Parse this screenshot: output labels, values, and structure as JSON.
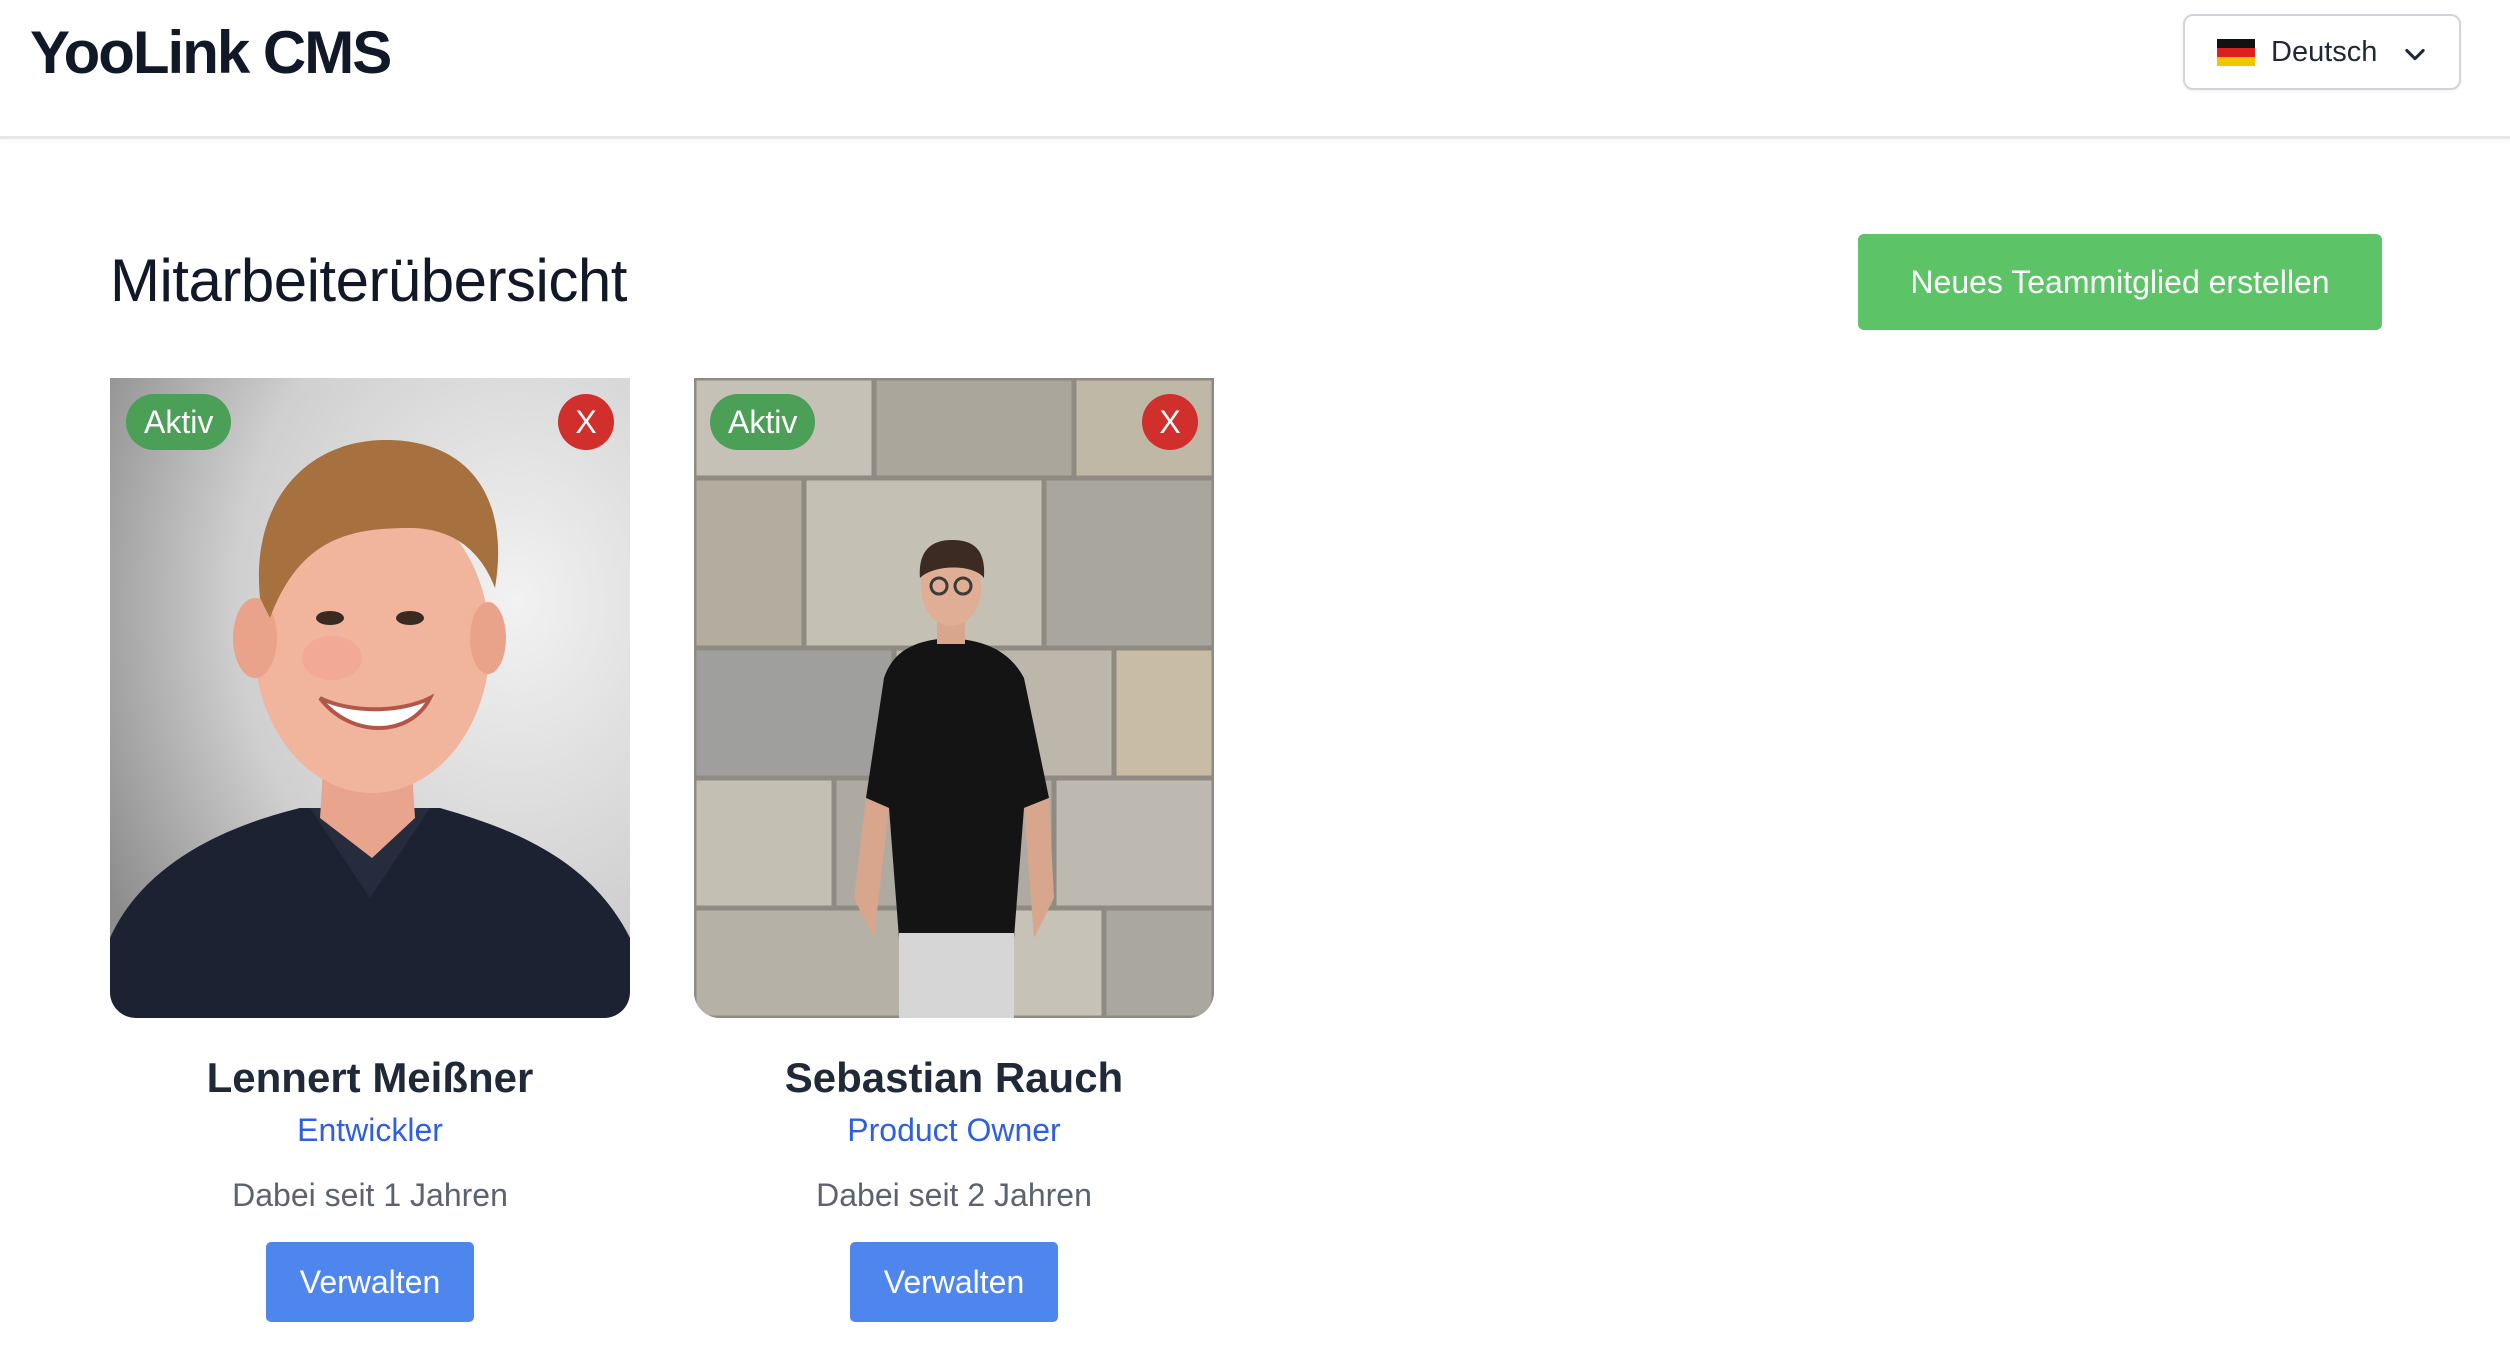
{
  "header": {
    "brand": "YooLink CMS",
    "language": {
      "selected": "Deutsch",
      "flag": "de"
    }
  },
  "main": {
    "title": "Mitarbeiterübersicht",
    "create_label": "Neues Teammitglied erstellen",
    "members": [
      {
        "name": "Lennert Meißner",
        "role": "Entwickler",
        "since": "Dabei seit 1 Jahren",
        "status": "Aktiv",
        "remove_label": "X",
        "manage_label": "Verwalten"
      },
      {
        "name": "Sebastian Rauch",
        "role": "Product Owner",
        "since": "Dabei seit 2 Jahren",
        "status": "Aktiv",
        "remove_label": "X",
        "manage_label": "Verwalten"
      }
    ]
  },
  "colors": {
    "create_button": "#5cc466",
    "active_badge": "#4c9f57",
    "remove_button": "#d12f2b",
    "manage_button": "#4f86ee",
    "role_text": "#2f5fe0"
  }
}
